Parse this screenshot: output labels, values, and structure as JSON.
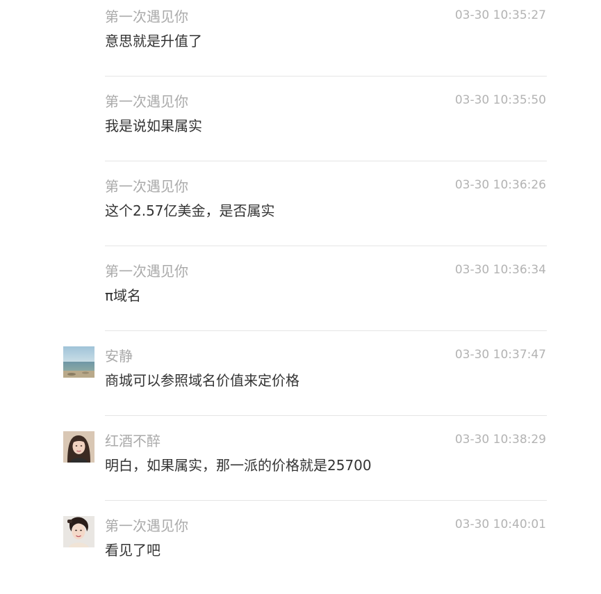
{
  "messages": [
    {
      "sender": "第一次遇见你",
      "time": "03-30 10:35:27",
      "text": "意思就是升值了",
      "avatar": null
    },
    {
      "sender": "第一次遇见你",
      "time": "03-30 10:35:50",
      "text": "我是说如果属实",
      "avatar": null
    },
    {
      "sender": "第一次遇见你",
      "time": "03-30 10:36:26",
      "text": "这个2.57亿美金，是否属实",
      "avatar": null
    },
    {
      "sender": "第一次遇见你",
      "time": "03-30 10:36:34",
      "text": "π域名",
      "avatar": null
    },
    {
      "sender": "安静",
      "time": "03-30 10:37:47",
      "text": "商城可以参照域名价值来定价格",
      "avatar": "beach-avatar"
    },
    {
      "sender": "红酒不醉",
      "time": "03-30 10:38:29",
      "text": "明白，如果属实，那一派的价格就是25700",
      "avatar": "woman-avatar"
    },
    {
      "sender": "第一次遇见你",
      "time": "03-30 10:40:01",
      "text": "看见了吧",
      "avatar": "woman-portrait-avatar"
    }
  ],
  "colors": {
    "sender": "#aaaaaa",
    "time": "#b3b3b3",
    "text": "#333333",
    "divider": "#e5e5e5"
  }
}
